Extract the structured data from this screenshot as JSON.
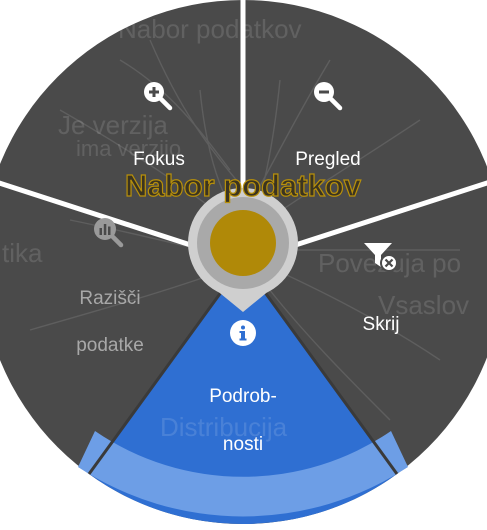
{
  "menu": {
    "center_color": "#b08908",
    "accent_color": "#2f6fd2",
    "items": [
      {
        "label": "Fokus",
        "icon": "zoom-in-icon",
        "active": false,
        "disabled": false
      },
      {
        "label": "Pregled",
        "icon": "zoom-out-icon",
        "active": false,
        "disabled": false
      },
      {
        "label": "Skrij",
        "icon": "filter-remove-icon",
        "active": false,
        "disabled": false
      },
      {
        "label_line1": "Podrob-",
        "label_line2": "nosti",
        "icon": "info-icon",
        "active": true,
        "disabled": false
      },
      {
        "label_line1": "Razišči",
        "label_line2": "podatke",
        "icon": "explore-data-icon",
        "active": false,
        "disabled": true
      }
    ]
  },
  "background": {
    "dataset_title": "Nabor podatkov",
    "top_text": "Nabor podatkov",
    "version_text_1": "Je verzija",
    "version_text_2": "ima verzijo",
    "right_text_1": "Povezuja po",
    "right_text_2": "Vsaslov",
    "bottom_text": "Distribucija",
    "left_text": "tika"
  }
}
